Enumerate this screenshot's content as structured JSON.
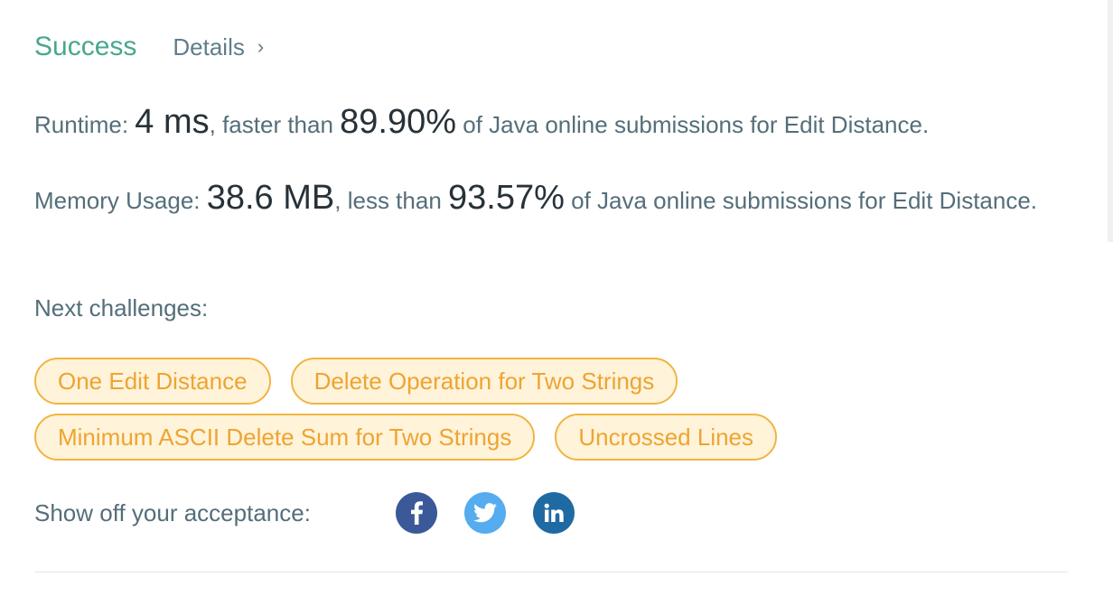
{
  "header": {
    "status": "Success",
    "details_label": "Details",
    "chevron": "›"
  },
  "runtime": {
    "label": "Runtime: ",
    "value": "4 ms",
    "compare": ", faster than ",
    "percent": "89.90%",
    "suffix": " of Java online submissions for Edit Distance."
  },
  "memory": {
    "label": "Memory Usage: ",
    "value": "38.6 MB",
    "compare": ", less than ",
    "percent": "93.57%",
    "suffix": " of Java online submissions for Edit Distance."
  },
  "next": {
    "label": "Next challenges:",
    "items": [
      "One Edit Distance",
      "Delete Operation for Two Strings",
      "Minimum ASCII Delete Sum for Two Strings",
      "Uncrossed Lines"
    ]
  },
  "share": {
    "label": "Show off your acceptance:",
    "icons": [
      "facebook-icon",
      "twitter-icon",
      "linkedin-icon"
    ]
  },
  "colors": {
    "success": "#47a88d",
    "tag_border": "#f0b541",
    "tag_text": "#eea431",
    "facebook": "#3b5998",
    "twitter": "#55acee",
    "linkedin": "#1f6aa3"
  }
}
